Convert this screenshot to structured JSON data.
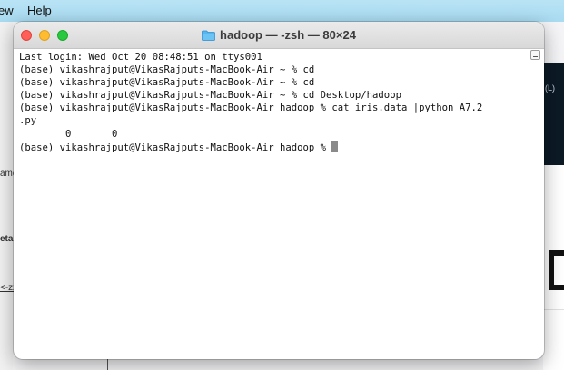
{
  "menubar": {
    "items": [
      "ew",
      "Help"
    ]
  },
  "background_app": {
    "left_texts": [
      "ame",
      "etar",
      "<-zz"
    ],
    "right_paren": "(L)"
  },
  "window": {
    "title": "hadoop — -zsh — 80×24",
    "icon": "folder-icon"
  },
  "terminal": {
    "lines": [
      "Last login: Wed Oct 20 08:48:51 on ttys001",
      "(base) vikashrajput@VikasRajputs-MacBook-Air ~ % cd",
      "(base) vikashrajput@VikasRajputs-MacBook-Air ~ % cd",
      "(base) vikashrajput@VikasRajputs-MacBook-Air ~ % cd Desktop/hadoop",
      "(base) vikashrajput@VikasRajputs-MacBook-Air hadoop % cat iris.data |python A7.2",
      ".py",
      "        0       0"
    ],
    "prompt": "(base) vikashrajput@VikasRajputs-MacBook-Air hadoop % "
  },
  "colors": {
    "close": "#fe5f57",
    "minimize": "#febc2e",
    "zoom": "#28c840",
    "menubar": "#b9e3f5"
  }
}
